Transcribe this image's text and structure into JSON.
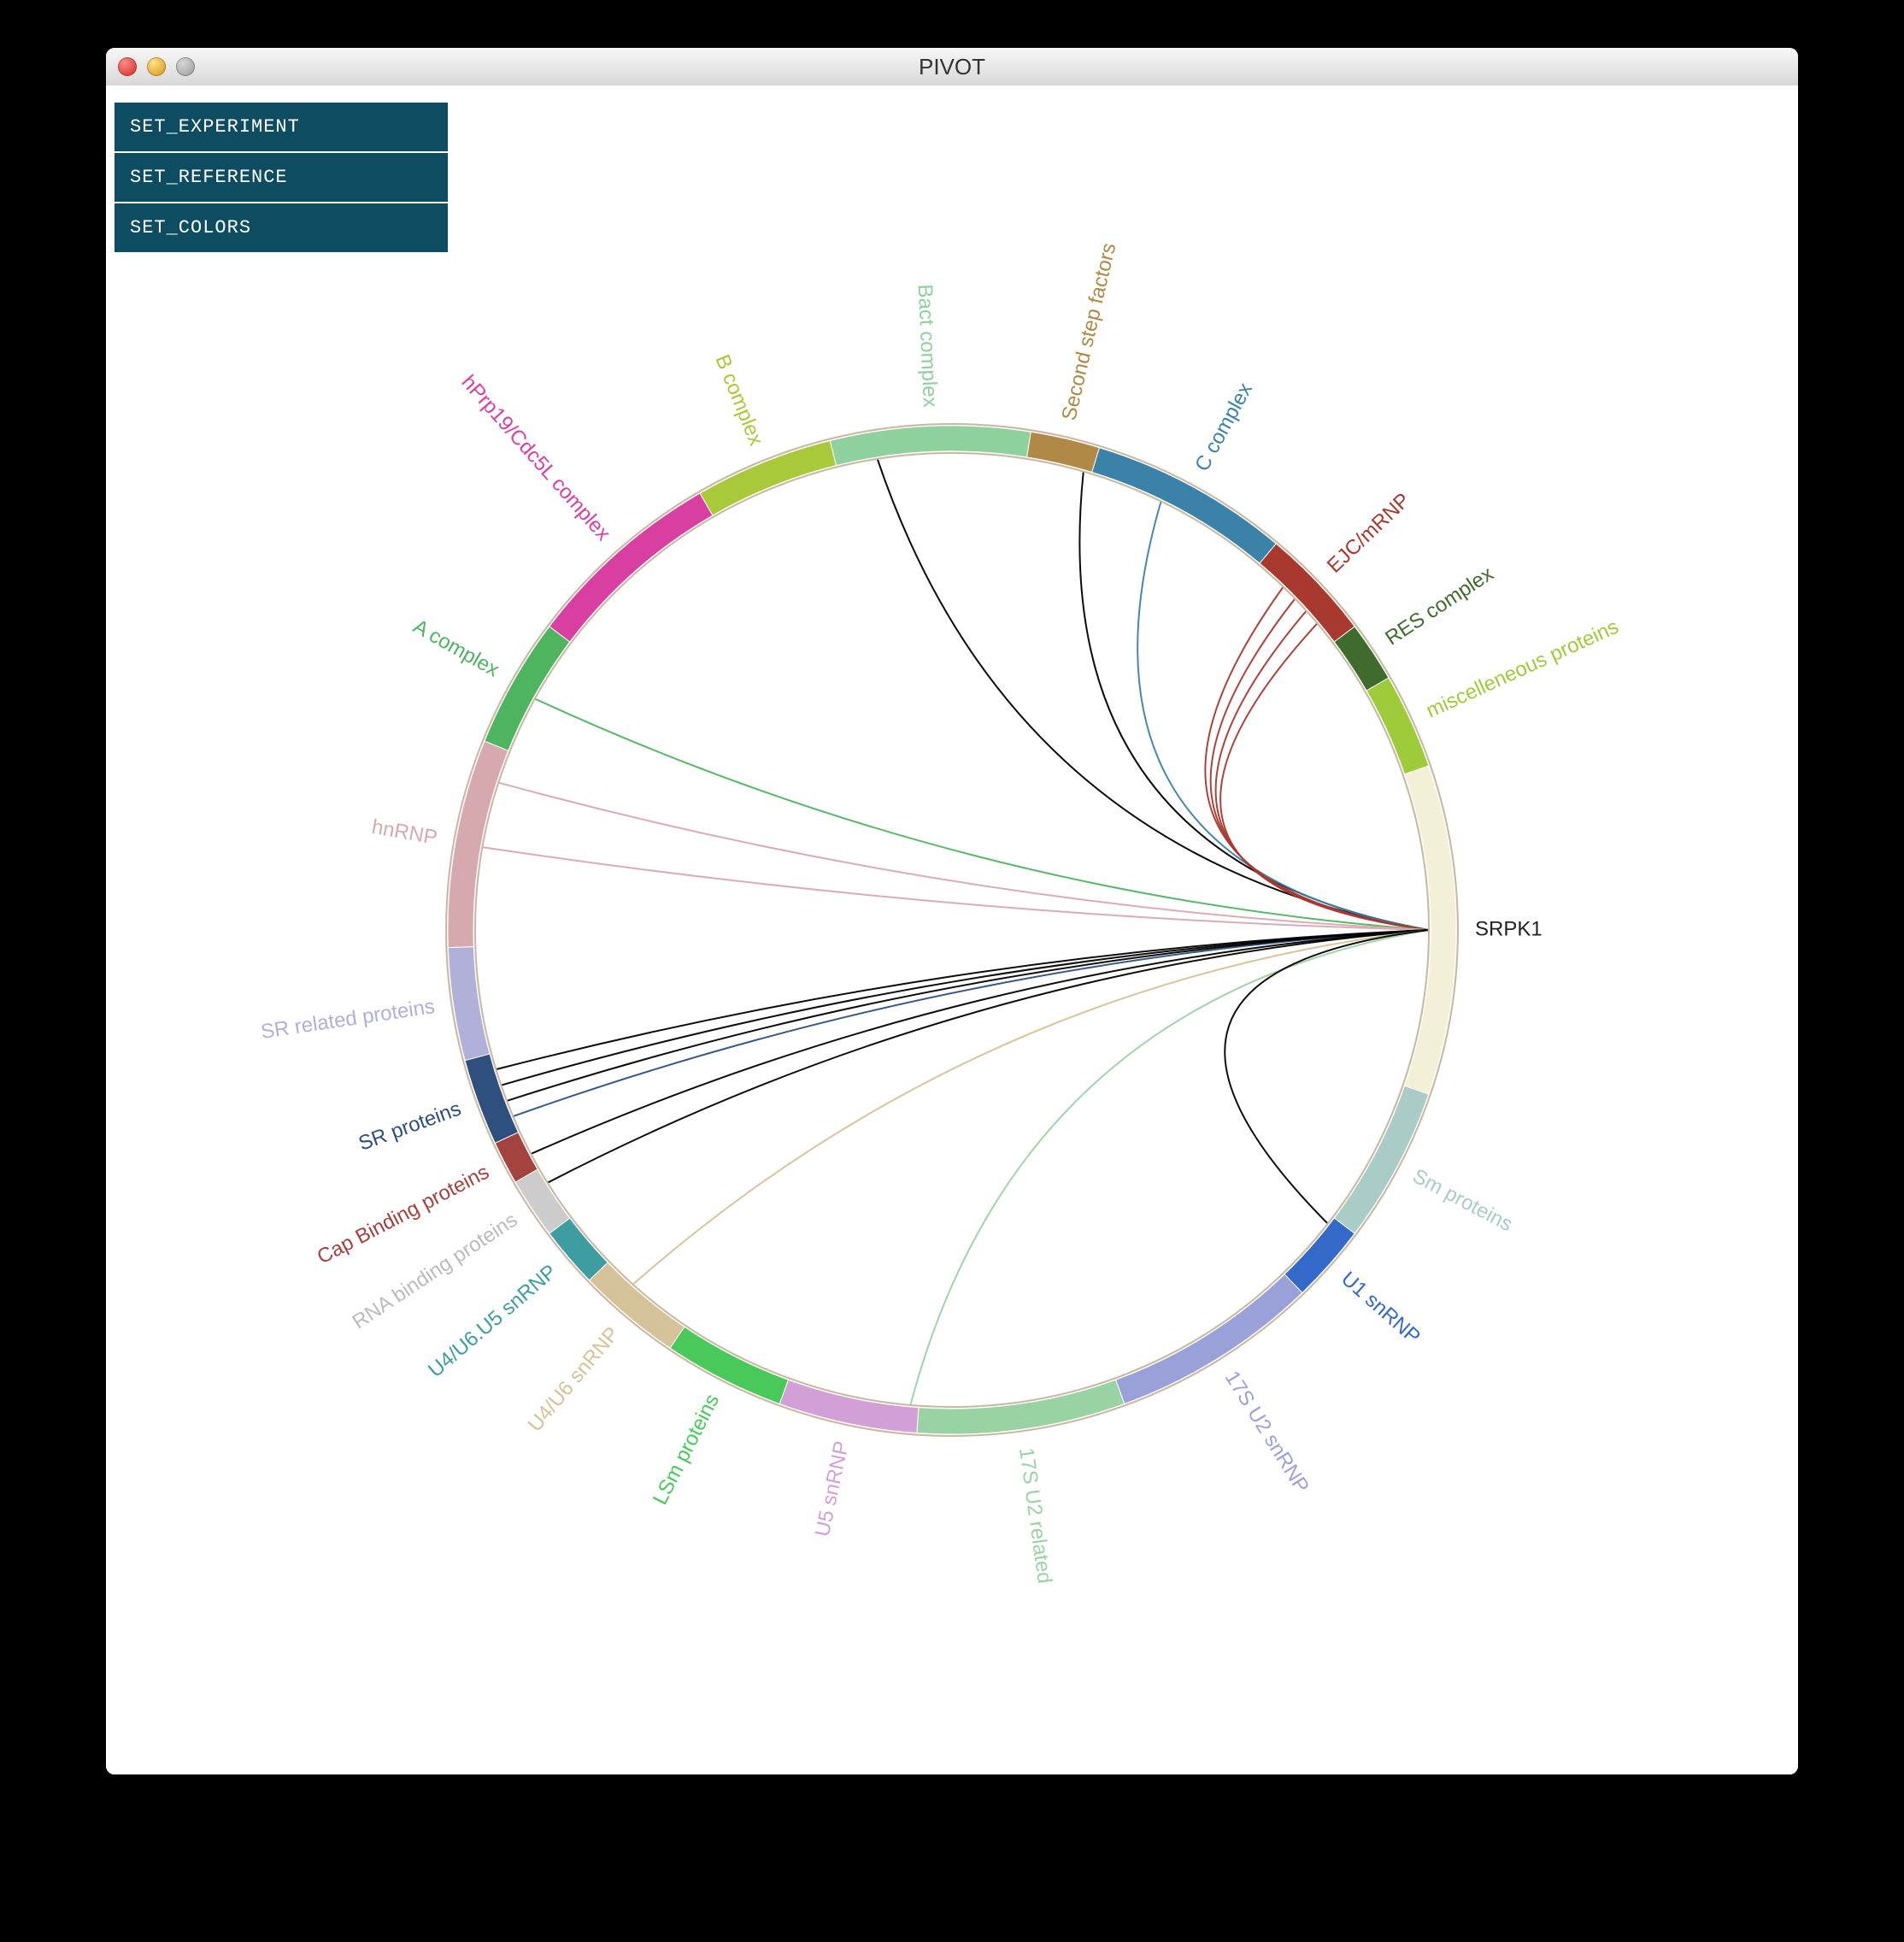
{
  "window": {
    "title": "PIVOT"
  },
  "menu": {
    "items": [
      "SET_EXPERIMENT",
      "SET_REFERENCE",
      "SET_COLORS"
    ]
  },
  "chart_data": {
    "type": "chord",
    "title": "",
    "focus_node": "SRPK1",
    "outer_radius": 590,
    "inner_radius": 560,
    "segments": [
      {
        "id": "srpk1",
        "label": "SRPK1",
        "start_deg": -19,
        "end_deg": 19,
        "color": "#f2f0d6",
        "label_color": "#222222"
      },
      {
        "id": "sm",
        "label": "Sm proteins",
        "start_deg": 19,
        "end_deg": 37,
        "color": "#a9ccc6",
        "label_color": "#a9ccc6"
      },
      {
        "id": "u1",
        "label": "U1 snRNP",
        "start_deg": 37,
        "end_deg": 46,
        "color": "#3369c9",
        "label_color": "#3369c9"
      },
      {
        "id": "u2",
        "label": "17S U2 snRNP",
        "start_deg": 46,
        "end_deg": 70,
        "color": "#9aa0d8",
        "label_color": "#9aa0d8"
      },
      {
        "id": "u2rel",
        "label": "17S U2 related",
        "start_deg": 70,
        "end_deg": 94,
        "color": "#9ad3a3",
        "label_color": "#9ad3a3"
      },
      {
        "id": "u5",
        "label": "U5 snRNP",
        "start_deg": 94,
        "end_deg": 110,
        "color": "#d2a0d7",
        "label_color": "#d2a0d7"
      },
      {
        "id": "lsm",
        "label": "LSm proteins",
        "start_deg": 110,
        "end_deg": 124,
        "color": "#49c95a",
        "label_color": "#49c95a"
      },
      {
        "id": "u46",
        "label": "U4/U6 snRNP",
        "start_deg": 124,
        "end_deg": 136,
        "color": "#d6c298",
        "label_color": "#d6c298"
      },
      {
        "id": "u46u5",
        "label": "U4/U6.U5 snRNP",
        "start_deg": 136,
        "end_deg": 143,
        "color": "#3d9da0",
        "label_color": "#3d9da0"
      },
      {
        "id": "rna",
        "label": "RNA binding proteins",
        "start_deg": 143,
        "end_deg": 150,
        "color": "#cccccc",
        "label_color": "#bbbbbb"
      },
      {
        "id": "cap",
        "label": "Cap Binding proteins",
        "start_deg": 150,
        "end_deg": 155,
        "color": "#a3433f",
        "label_color": "#a3433f"
      },
      {
        "id": "sr",
        "label": "SR proteins",
        "start_deg": 155,
        "end_deg": 165,
        "color": "#2f4f7f",
        "label_color": "#2f4f7f"
      },
      {
        "id": "srrel",
        "label": "SR related proteins",
        "start_deg": 165,
        "end_deg": 178,
        "color": "#b0b0d8",
        "label_color": "#b0b0d8"
      },
      {
        "id": "hnrnp",
        "label": "hnRNP",
        "start_deg": 178,
        "end_deg": 202,
        "color": "#d6a9af",
        "label_color": "#d6a9af"
      },
      {
        "id": "acomp",
        "label": "A complex",
        "start_deg": 202,
        "end_deg": 217,
        "color": "#4eb460",
        "label_color": "#4eb460"
      },
      {
        "id": "hprp19",
        "label": "hPrp19/Cdc5L complex",
        "start_deg": 217,
        "end_deg": 240,
        "color": "#d93fa0",
        "label_color": "#d93fa0"
      },
      {
        "id": "bcomp",
        "label": "B complex",
        "start_deg": 240,
        "end_deg": 256,
        "color": "#a8c93a",
        "label_color": "#a8c93a"
      },
      {
        "id": "bact",
        "label": "Bact complex",
        "start_deg": 256,
        "end_deg": 279,
        "color": "#8ed09e",
        "label_color": "#8ed09e"
      },
      {
        "id": "second",
        "label": "Second step factors",
        "start_deg": 279,
        "end_deg": 287,
        "color": "#b18946",
        "label_color": "#b18946"
      },
      {
        "id": "ccomp",
        "label": "C complex",
        "start_deg": 287,
        "end_deg": 310,
        "color": "#3b82a9",
        "label_color": "#3b82a9"
      },
      {
        "id": "ejc",
        "label": "EJC/mRNP",
        "start_deg": 310,
        "end_deg": 323,
        "color": "#a9382f",
        "label_color": "#a9382f"
      },
      {
        "id": "res",
        "label": "RES complex",
        "start_deg": 323,
        "end_deg": 330,
        "color": "#3f6b2d",
        "label_color": "#3f6b2d"
      },
      {
        "id": "misc",
        "label": "miscelleneous proteins",
        "start_deg": 330,
        "end_deg": 341,
        "color": "#9ecb3a",
        "label_color": "#9ecb3a"
      }
    ],
    "connections_from_focus": [
      {
        "to_deg": 286,
        "color": "#000000"
      },
      {
        "to_deg": 261,
        "color": "#000000"
      },
      {
        "to_deg": 296,
        "color": "#3b82a9"
      },
      {
        "to_deg": 314,
        "color": "#a9382f"
      },
      {
        "to_deg": 316,
        "color": "#a9382f"
      },
      {
        "to_deg": 318,
        "color": "#a9382f"
      },
      {
        "to_deg": 320,
        "color": "#a9382f"
      },
      {
        "to_deg": 209,
        "color": "#4eb460"
      },
      {
        "to_deg": 198,
        "color": "#d6a9af"
      },
      {
        "to_deg": 190,
        "color": "#d6a9af"
      },
      {
        "to_deg": 157,
        "color": "#2f4f7f"
      },
      {
        "to_deg": 159,
        "color": "#000000"
      },
      {
        "to_deg": 161,
        "color": "#000000"
      },
      {
        "to_deg": 163,
        "color": "#000000"
      },
      {
        "to_deg": 152,
        "color": "#000000"
      },
      {
        "to_deg": 148,
        "color": "#000000"
      },
      {
        "to_deg": 132,
        "color": "#d6c298"
      },
      {
        "to_deg": 95,
        "color": "#9ad3a3"
      },
      {
        "to_deg": 38,
        "color": "#000000"
      }
    ]
  }
}
